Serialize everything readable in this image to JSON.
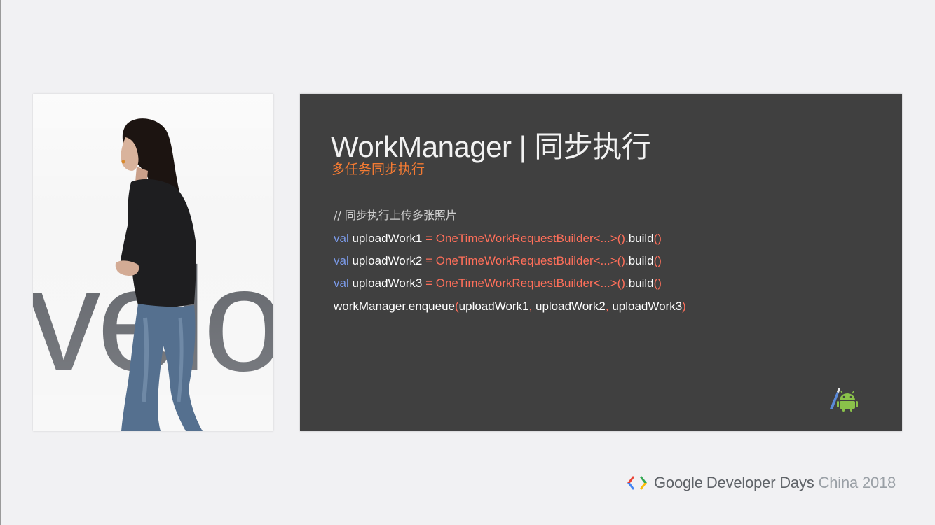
{
  "video": {
    "backdrop_text": "velo"
  },
  "slide": {
    "title": "WorkManager | 同步执行",
    "subtitle": "多任务同步执行",
    "comment": "// 同步执行上传多张照片",
    "code_lines": [
      {
        "kw": "val",
        "name": "uploadWork1",
        "eq": "=",
        "call": "OneTimeWorkRequestBuilder<...>()",
        "dot": ".",
        "method": "build",
        "parens": "()"
      },
      {
        "kw": "val",
        "name": "uploadWork2",
        "eq": "=",
        "call": "OneTimeWorkRequestBuilder<...>()",
        "dot": ".",
        "method": "build",
        "parens": "()"
      },
      {
        "kw": "val",
        "name": "uploadWork3",
        "eq": "=",
        "call": "OneTimeWorkRequestBuilder<...>()",
        "dot": ".",
        "method": "build",
        "parens": "()"
      }
    ],
    "enqueue_line": {
      "obj": "workManager",
      "dot": ".",
      "method": "enqueue",
      "open": "(",
      "arg1": "uploadWork1",
      "comma1": ",",
      "arg2": "uploadWork2",
      "comma2": ",",
      "arg3": "uploadWork3",
      "close": ")"
    },
    "corner_icon": "android-studio-icon"
  },
  "footer": {
    "brand_google": "Google",
    "brand_rest": "Developer Days",
    "brand_event": "China 2018"
  },
  "colors": {
    "slide_bg": "#404040",
    "accent_orange": "#f47b33",
    "keyword_blue": "#7b9ae8",
    "code_red": "#ff6f5a",
    "page_bg": "#f1f1f3"
  }
}
